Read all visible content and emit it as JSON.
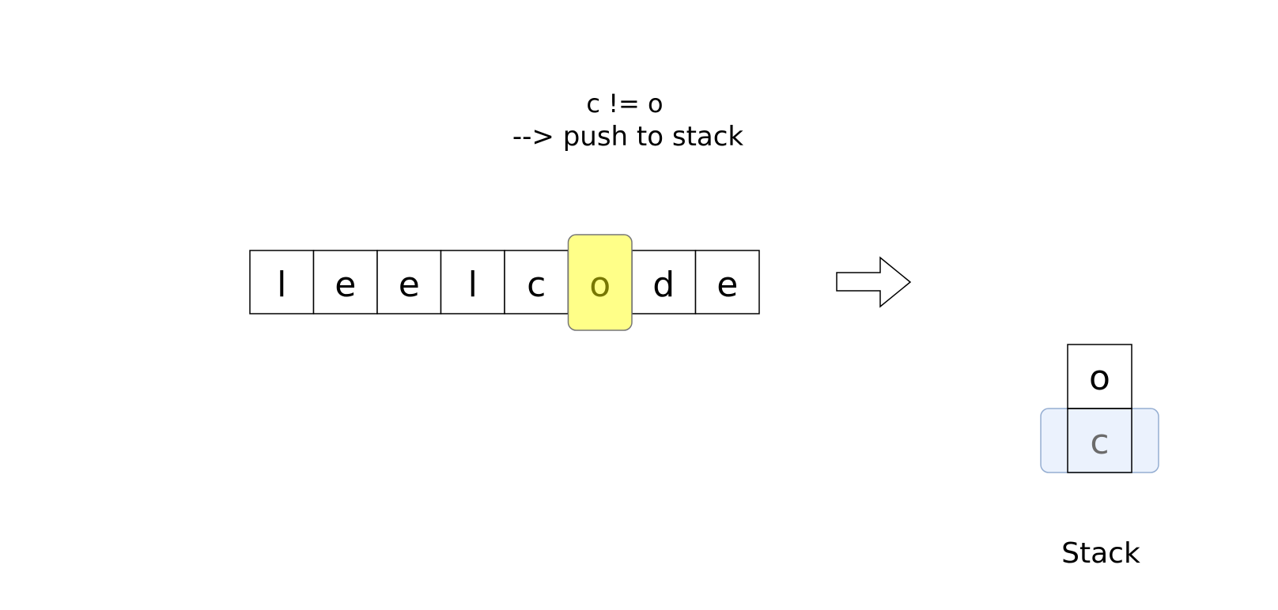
{
  "caption": {
    "line1": "c != o",
    "line2": "--> push to stack"
  },
  "string_cells": [
    "l",
    "e",
    "e",
    "l",
    "c",
    "o",
    "d",
    "e"
  ],
  "highlight_index": 5,
  "stack": {
    "label": "Stack",
    "items_top_to_bottom": [
      "o",
      "c"
    ],
    "highlight_index": 1
  },
  "colors": {
    "highlight_fill": "#ffff88",
    "highlight_stroke": "#777777",
    "highlight_text": "#777700",
    "stack_highlight_fill": "#dae8fc",
    "stack_highlight_stroke": "#6c8ebf",
    "stack_highlight_text": "#6b6b6b",
    "cell_stroke": "#000000",
    "text": "#000000"
  }
}
